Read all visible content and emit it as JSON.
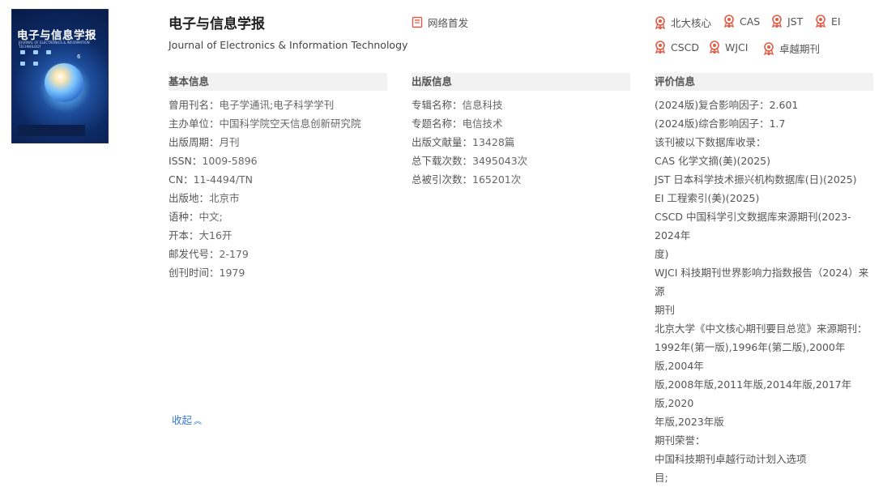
{
  "journal": {
    "title": "电子与信息学报",
    "subtitle": "Journal of Electronics & Information Technology",
    "online_first": "网络首发"
  },
  "cover": {
    "title": "电子与信息学报",
    "english": "JOURNAL OF ELECTRONICS & INFORMATION TECHNOLOGY",
    "issue": "6"
  },
  "badges": [
    "北大核心",
    "CAS",
    "JST",
    "EI",
    "CSCD",
    "WJCI",
    "卓越期刊"
  ],
  "sections": {
    "basic": "基本信息",
    "publish": "出版信息",
    "eval": "评价信息"
  },
  "basic_info": [
    {
      "label": "曾用刊名：",
      "value": "电子学通讯;电子科学学刊"
    },
    {
      "label": "主办单位：",
      "value": "中国科学院空天信息创新研究院"
    },
    {
      "label": "出版周期：",
      "value": "月刊"
    },
    {
      "label": "ISSN：",
      "value": "1009-5896"
    },
    {
      "label": "CN：",
      "value": "11-4494/TN"
    },
    {
      "label": "出版地：",
      "value": "北京市"
    },
    {
      "label": "语种：",
      "value": "中文;"
    },
    {
      "label": "开本：",
      "value": "大16开"
    },
    {
      "label": "邮发代号：",
      "value": "2-179"
    },
    {
      "label": "创刊时间：",
      "value": "1979"
    }
  ],
  "publish_info": [
    {
      "label": "专辑名称：",
      "value": "信息科技"
    },
    {
      "label": "专题名称：",
      "value": "电信技术"
    },
    {
      "label": "出版文献量：",
      "value": "13428篇"
    },
    {
      "label": "总下载次数：",
      "value": "3495043次"
    },
    {
      "label": "总被引次数：",
      "value": "165201次"
    }
  ],
  "eval_info": [
    "(2024版)复合影响因子：2.601",
    "(2024版)综合影响因子：1.7",
    "该刊被以下数据库收录：",
    "CAS 化学文摘(美)(2025)",
    "JST 日本科学技术振兴机构数据库(日)(2025)",
    "EI 工程索引(美)(2025)",
    "CSCD 中国科学引文数据库来源期刊(2023-2024年",
    "度)",
    "WJCI 科技期刊世界影响力指数报告（2024）来源",
    "期刊",
    "北京大学《中文核心期刊要目总览》来源期刊：",
    "1992年(第一版),1996年(第二版),2000年版,2004年",
    "版,2008年版,2011年版,2014年版,2017年版,2020",
    "年版,2023年版",
    "期刊荣誉：",
    "中国科技期刊卓越行动计划入选项",
    "目;"
  ],
  "collapse_label": "收起",
  "colors": {
    "badge_red": "#e05b45",
    "link_blue": "#3a7bd5",
    "header_bg": "#f2f2f2"
  }
}
